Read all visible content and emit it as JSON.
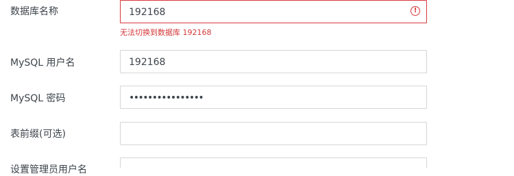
{
  "form": {
    "db_name": {
      "label": "数据库名称",
      "value": "192168",
      "error_icon": "exclamation-circle-icon",
      "error_symbol": "!",
      "error_message": "无法切换到数据库 192168"
    },
    "mysql_user": {
      "label": "MySQL 用户名",
      "value": "192168"
    },
    "mysql_password": {
      "label": "MySQL 密码",
      "masked_value": "••••••••••••••••"
    },
    "table_prefix": {
      "label": "表前缀(可选)",
      "value": ""
    },
    "admin_user": {
      "label": "设置管理员用户名",
      "value": ""
    }
  },
  "colors": {
    "error": "#d63638",
    "border": "#d5d5d5",
    "text": "#3c434a"
  }
}
